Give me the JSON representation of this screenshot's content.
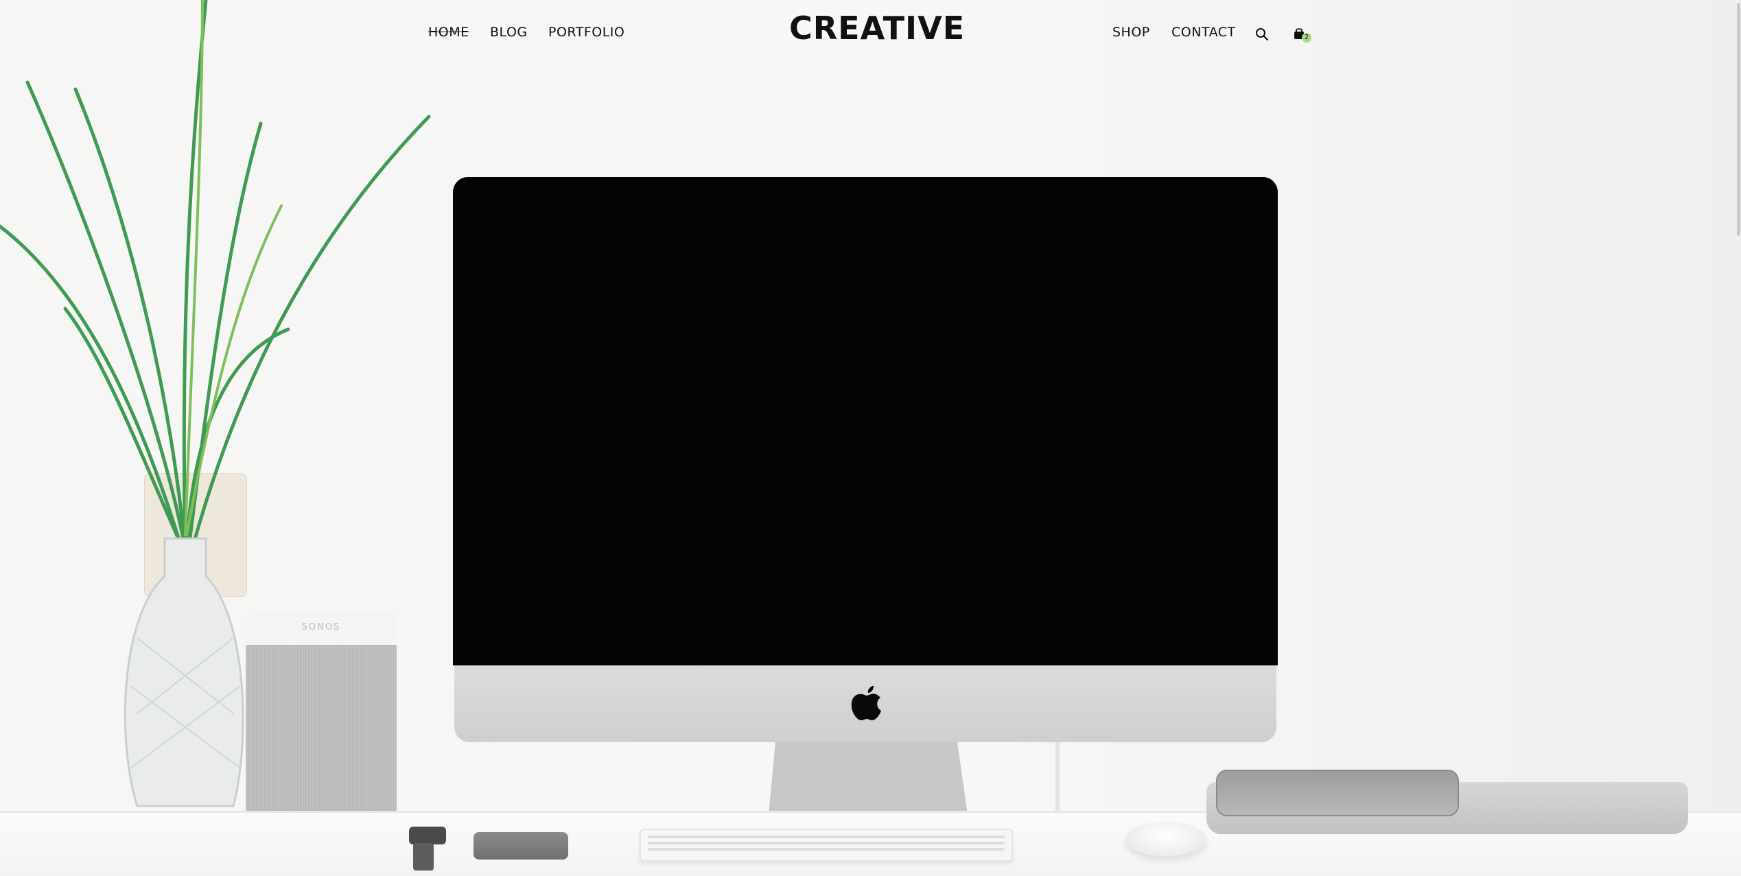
{
  "header": {
    "nav_left": [
      {
        "label": "HOME",
        "active": true
      },
      {
        "label": "BLOG",
        "active": false
      },
      {
        "label": "PORTFOLIO",
        "active": false
      }
    ],
    "logo": "CREATIVE",
    "nav_right": [
      {
        "label": "SHOP"
      },
      {
        "label": "CONTACT"
      }
    ],
    "search_icon": "search-icon",
    "cart": {
      "icon": "shopping-bag-icon",
      "count": "2",
      "badge_color": "#a8d88a"
    }
  },
  "hero": {
    "speaker_brand": "SONOS"
  },
  "colors": {
    "text": "#111111",
    "background": "#f7f6f5",
    "screen": "#030405"
  }
}
